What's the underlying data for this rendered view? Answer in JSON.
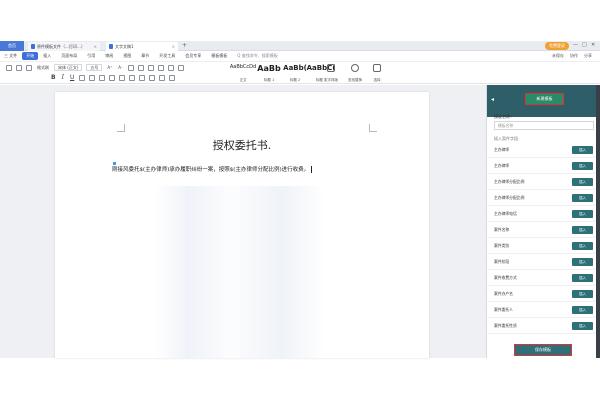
{
  "tabs": {
    "home": "首页",
    "doc1": "原件模板文件（…打印…）",
    "doc2": "文字文稿1",
    "plus": "+",
    "login": "免费登录"
  },
  "window_controls": {
    "minimize": "—",
    "maximize": "□",
    "close": "✕"
  },
  "menu": {
    "file": "三 文件",
    "items": [
      "开始",
      "插入",
      "页面布局",
      "引用",
      "审阅",
      "视图",
      "章节",
      "开发工具",
      "会员专享",
      "模板模板"
    ],
    "active": "开始",
    "search": "Q 查找命令、搜索模板",
    "right": [
      "未保存",
      "协作",
      "分享"
    ]
  },
  "toolbar": {
    "row1": [
      "格式刷",
      "宋体 (正文)",
      "五号",
      "A⁺",
      "A⁻"
    ],
    "row2": [
      "B",
      "I",
      "U"
    ],
    "styles": [
      {
        "sample": "AaBbCcDd",
        "label": "正文"
      },
      {
        "sample": "AaBb",
        "label": "标题 1"
      },
      {
        "sample": "AaBb(",
        "label": "标题 2"
      },
      {
        "sample": "AaBbC(",
        "label": "标题 3"
      }
    ],
    "big_buttons": [
      "文字排版",
      "查找替换",
      "选择"
    ]
  },
  "document": {
    "title": "授权委托书.",
    "body": "刚接风委托$(主办律师)承办履职纠纷一案，按照$(主办律师分配比例)进行收费。"
  },
  "sidebar": {
    "new_template": "新建模板",
    "name_label": "模板名称：",
    "name_placeholder": "模板名称",
    "insert_label": "插入案件字段",
    "insert_button": "插入",
    "fields": [
      "主办律师",
      "主办律师",
      "主办律师分配比例",
      "主办律师分配比例",
      "主办律师电话",
      "案件名称",
      "案件类别",
      "案件阶段",
      "案件收费方式",
      "案件办户名",
      "案件委托人",
      "案件委托性质"
    ],
    "save": "保存模板"
  }
}
